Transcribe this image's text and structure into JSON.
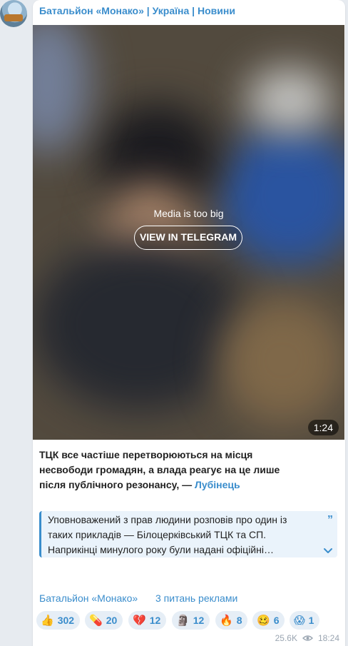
{
  "channel": {
    "name": "Батальйон «Монако» | Україна | Новини"
  },
  "media": {
    "notice": "Media is too big",
    "view_button": "VIEW IN TELEGRAM",
    "duration": "1:24"
  },
  "post": {
    "text": "ТЦК все частіше перетворюються на місця несвободи громадян, а влада реагує на це лише після публічного резонансу, —",
    "link": "Лубінець"
  },
  "quote": {
    "lines": [
      "Уповноважений з прав людини розповів про один із",
      "таких прикладів — Білоцерківський ТЦК та СП.",
      "Наприкінці минулого року були надані офіційні…"
    ]
  },
  "footer": {
    "link1": "Батальйон «Монако»",
    "link2": "3 питань реклами"
  },
  "reactions": [
    {
      "emoji": "👍",
      "icon": "thumbs-up-icon",
      "count": "302"
    },
    {
      "emoji": "💊",
      "icon": "pill-icon",
      "count": "20"
    },
    {
      "emoji": "💔",
      "icon": "broken-heart-icon",
      "count": "12"
    },
    {
      "emoji": "🗿",
      "icon": "moai-icon",
      "count": "12"
    },
    {
      "emoji": "🔥",
      "icon": "fire-icon",
      "count": "8"
    },
    {
      "emoji": "🥴",
      "icon": "woozy-face-icon",
      "count": "6"
    },
    {
      "emoji": "😱",
      "icon": "screaming-face-icon",
      "count": "1"
    }
  ],
  "meta": {
    "views": "25.6K",
    "time": "18:24"
  },
  "colors": {
    "accent": "#3a8dcc",
    "bubble": "#ffffff",
    "background": "#e7ebf0"
  }
}
